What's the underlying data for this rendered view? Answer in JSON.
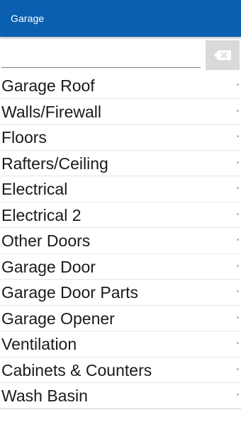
{
  "app_bar": {
    "title": "Garage",
    "color": "#0a5fb0"
  },
  "search": {
    "value": "",
    "placeholder": "",
    "clear_icon": "backspace-clear-icon"
  },
  "list": {
    "items": [
      {
        "label": "Garage Roof"
      },
      {
        "label": "Walls/Firewall"
      },
      {
        "label": "Floors"
      },
      {
        "label": "Rafters/Ceiling"
      },
      {
        "label": "Electrical"
      },
      {
        "label": "Electrical 2"
      },
      {
        "label": "Other Doors"
      },
      {
        "label": "Garage Door"
      },
      {
        "label": "Garage Door Parts"
      },
      {
        "label": "Garage Opener"
      },
      {
        "label": "Ventilation"
      },
      {
        "label": "Cabinets & Counters"
      },
      {
        "label": "Wash Basin"
      }
    ],
    "item_icon": "chevron-right-icon"
  }
}
